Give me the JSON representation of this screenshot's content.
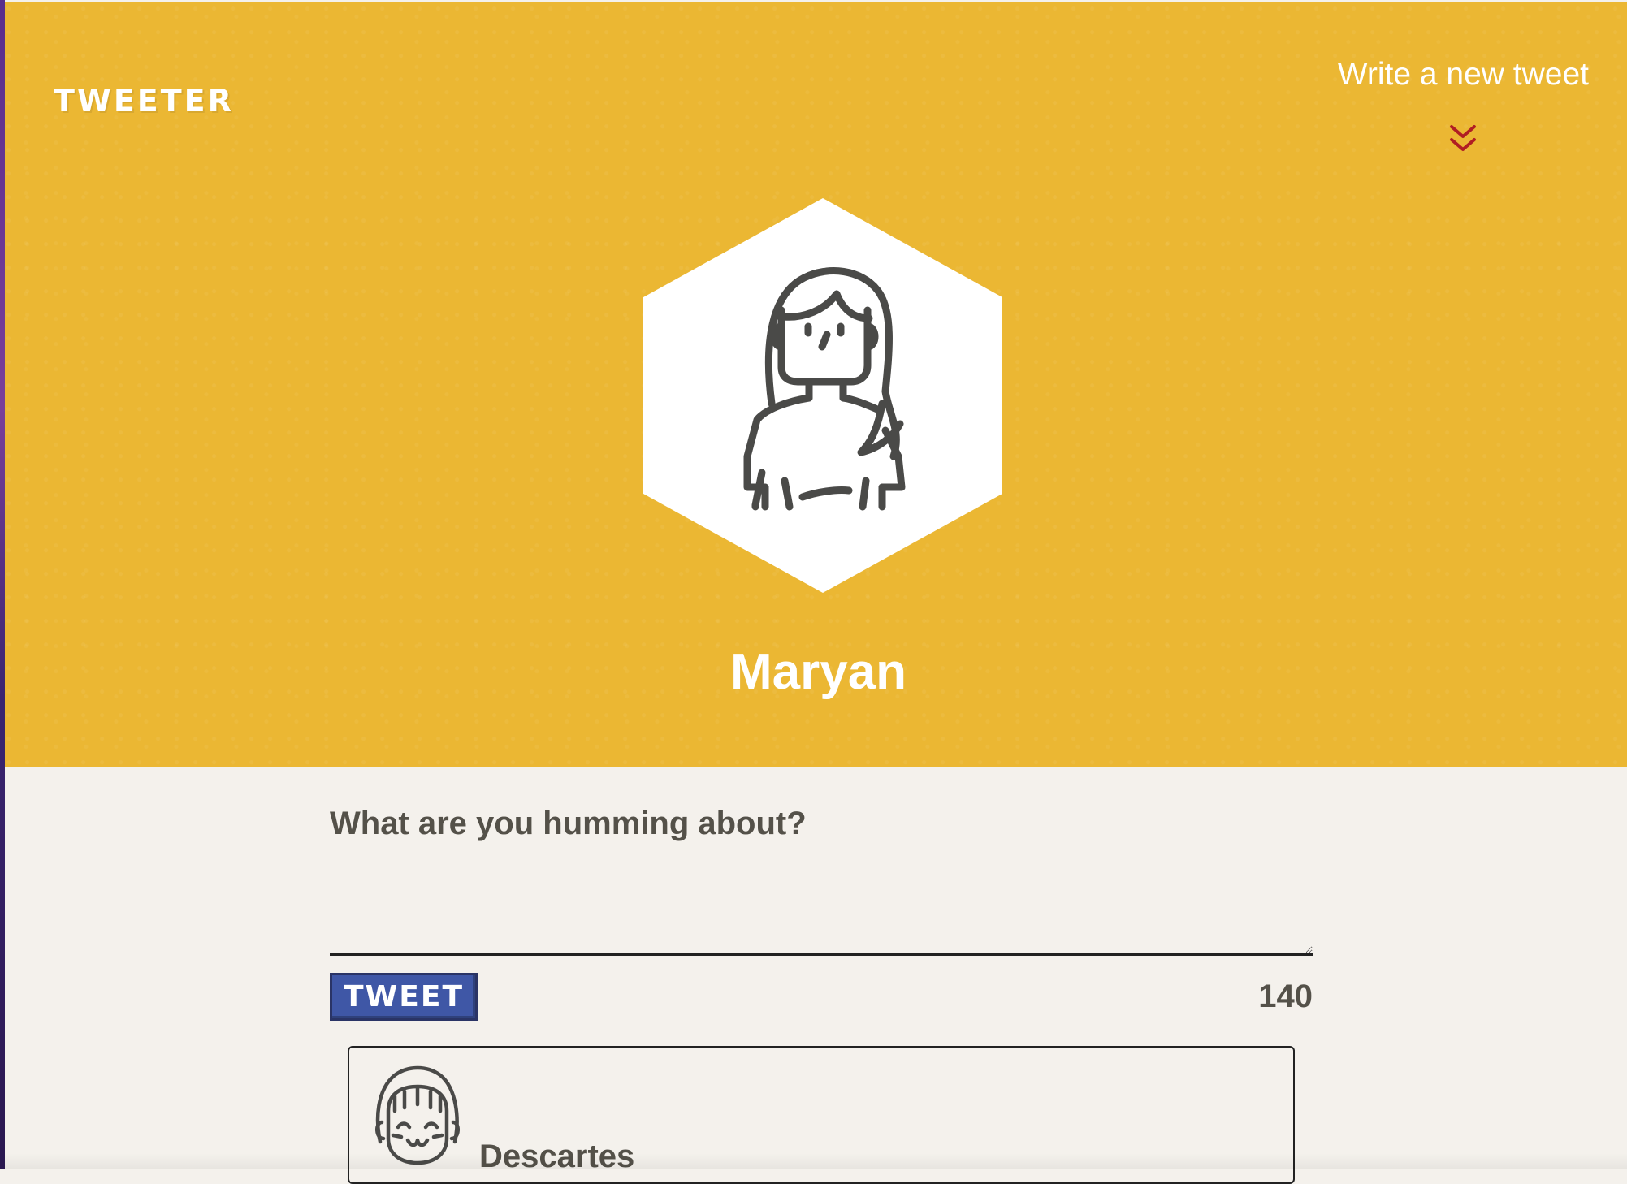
{
  "header": {
    "brand": "TWEETER",
    "compose_link": "Write a new tweet",
    "compose_icon": "double-chevron-down-icon",
    "user_name": "Maryan",
    "avatar_icon": "woman-avatar-icon",
    "background_color": "#ebb733"
  },
  "composer": {
    "label": "What are you humming about?",
    "textarea_value": "",
    "tweet_button": "TWEET",
    "char_count": "140",
    "button_color": "#3f57a6"
  },
  "tweets": [
    {
      "author": "Descartes",
      "avatar_icon": "smiling-girl-avatar-icon"
    }
  ]
}
